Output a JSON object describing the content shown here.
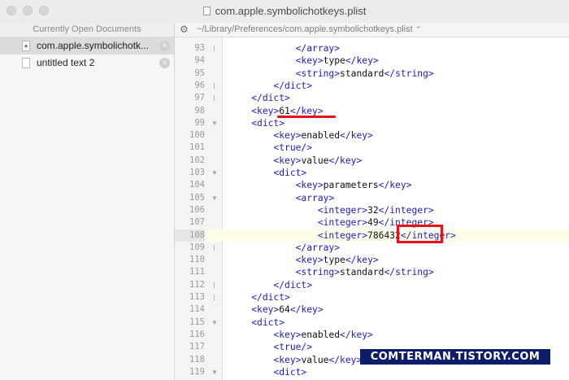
{
  "window": {
    "title": "com.apple.symbolichotkeys.plist"
  },
  "sidebar": {
    "header": "Currently Open Documents",
    "documents": [
      {
        "name": "com.apple.symbolichotk...",
        "selected": true,
        "close_icon": "close-icon"
      },
      {
        "name": "untitled text 2",
        "selected": false,
        "close_icon": "close-icon"
      }
    ]
  },
  "pathbar": {
    "icon": "gear-icon",
    "path": "~/Library/Preferences/com.apple.symbolichotkeys.plist",
    "chevron": "⌃"
  },
  "editor": {
    "current_line": "108",
    "lines": [
      {
        "n": "93",
        "fold": "end",
        "indent": "            ",
        "parts": [
          [
            "t",
            "</array>"
          ]
        ]
      },
      {
        "n": "94",
        "fold": "",
        "indent": "            ",
        "parts": [
          [
            "t",
            "<key>"
          ],
          [
            "x",
            "type"
          ],
          [
            "t",
            "</key>"
          ]
        ]
      },
      {
        "n": "95",
        "fold": "",
        "indent": "            ",
        "parts": [
          [
            "t",
            "<string>"
          ],
          [
            "x",
            "standard"
          ],
          [
            "t",
            "</string>"
          ]
        ]
      },
      {
        "n": "96",
        "fold": "end",
        "indent": "        ",
        "parts": [
          [
            "t",
            "</dict>"
          ]
        ]
      },
      {
        "n": "97",
        "fold": "end",
        "indent": "    ",
        "parts": [
          [
            "t",
            "</dict>"
          ]
        ]
      },
      {
        "n": "98",
        "fold": "",
        "indent": "    ",
        "parts": [
          [
            "t",
            "<key>"
          ],
          [
            "x",
            "61"
          ],
          [
            "t",
            "</key>"
          ]
        ]
      },
      {
        "n": "99",
        "fold": "start",
        "indent": "    ",
        "parts": [
          [
            "t",
            "<dict>"
          ]
        ]
      },
      {
        "n": "100",
        "fold": "",
        "indent": "        ",
        "parts": [
          [
            "t",
            "<key>"
          ],
          [
            "x",
            "enabled"
          ],
          [
            "t",
            "</key>"
          ]
        ]
      },
      {
        "n": "101",
        "fold": "",
        "indent": "        ",
        "parts": [
          [
            "t",
            "<true/>"
          ]
        ]
      },
      {
        "n": "102",
        "fold": "",
        "indent": "        ",
        "parts": [
          [
            "t",
            "<key>"
          ],
          [
            "x",
            "value"
          ],
          [
            "t",
            "</key>"
          ]
        ]
      },
      {
        "n": "103",
        "fold": "start",
        "indent": "        ",
        "parts": [
          [
            "t",
            "<dict>"
          ]
        ]
      },
      {
        "n": "104",
        "fold": "",
        "indent": "            ",
        "parts": [
          [
            "t",
            "<key>"
          ],
          [
            "x",
            "parameters"
          ],
          [
            "t",
            "</key>"
          ]
        ]
      },
      {
        "n": "105",
        "fold": "start",
        "indent": "            ",
        "parts": [
          [
            "t",
            "<array>"
          ]
        ]
      },
      {
        "n": "106",
        "fold": "",
        "indent": "                ",
        "parts": [
          [
            "t",
            "<integer>"
          ],
          [
            "x",
            "32"
          ],
          [
            "t",
            "</integer>"
          ]
        ]
      },
      {
        "n": "107",
        "fold": "",
        "indent": "                ",
        "parts": [
          [
            "t",
            "<integer>"
          ],
          [
            "x",
            "49"
          ],
          [
            "t",
            "</integer>"
          ]
        ]
      },
      {
        "n": "108",
        "fold": "",
        "indent": "                ",
        "parts": [
          [
            "t",
            "<integer>"
          ],
          [
            "x",
            "786432"
          ],
          [
            "t",
            "</integer>"
          ]
        ]
      },
      {
        "n": "109",
        "fold": "end",
        "indent": "            ",
        "parts": [
          [
            "t",
            "</array>"
          ]
        ]
      },
      {
        "n": "110",
        "fold": "",
        "indent": "            ",
        "parts": [
          [
            "t",
            "<key>"
          ],
          [
            "x",
            "type"
          ],
          [
            "t",
            "</key>"
          ]
        ]
      },
      {
        "n": "111",
        "fold": "",
        "indent": "            ",
        "parts": [
          [
            "t",
            "<string>"
          ],
          [
            "x",
            "standard"
          ],
          [
            "t",
            "</string>"
          ]
        ]
      },
      {
        "n": "112",
        "fold": "end",
        "indent": "        ",
        "parts": [
          [
            "t",
            "</dict>"
          ]
        ]
      },
      {
        "n": "113",
        "fold": "end",
        "indent": "    ",
        "parts": [
          [
            "t",
            "</dict>"
          ]
        ]
      },
      {
        "n": "114",
        "fold": "",
        "indent": "    ",
        "parts": [
          [
            "t",
            "<key>"
          ],
          [
            "x",
            "64"
          ],
          [
            "t",
            "</key>"
          ]
        ]
      },
      {
        "n": "115",
        "fold": "start",
        "indent": "    ",
        "parts": [
          [
            "t",
            "<dict>"
          ]
        ]
      },
      {
        "n": "116",
        "fold": "",
        "indent": "        ",
        "parts": [
          [
            "t",
            "<key>"
          ],
          [
            "x",
            "enabled"
          ],
          [
            "t",
            "</key>"
          ]
        ]
      },
      {
        "n": "117",
        "fold": "",
        "indent": "        ",
        "parts": [
          [
            "t",
            "<true/>"
          ]
        ]
      },
      {
        "n": "118",
        "fold": "",
        "indent": "        ",
        "parts": [
          [
            "t",
            "<key>"
          ],
          [
            "x",
            "value"
          ],
          [
            "t",
            "</key>"
          ]
        ]
      },
      {
        "n": "119",
        "fold": "start",
        "indent": "        ",
        "parts": [
          [
            "t",
            "<dict>"
          ]
        ]
      }
    ]
  },
  "annotations": {
    "highlight_color": "#e8101a",
    "underline_target": "98",
    "box_target": "108"
  },
  "watermark": {
    "text": "COMTERMAN.TISTORY.COM"
  },
  "colors": {
    "tag": "#1a1ac8",
    "text": "#111111",
    "current_line_bg": "#fdfde8",
    "watermark_bg": "#0d1d6a"
  }
}
